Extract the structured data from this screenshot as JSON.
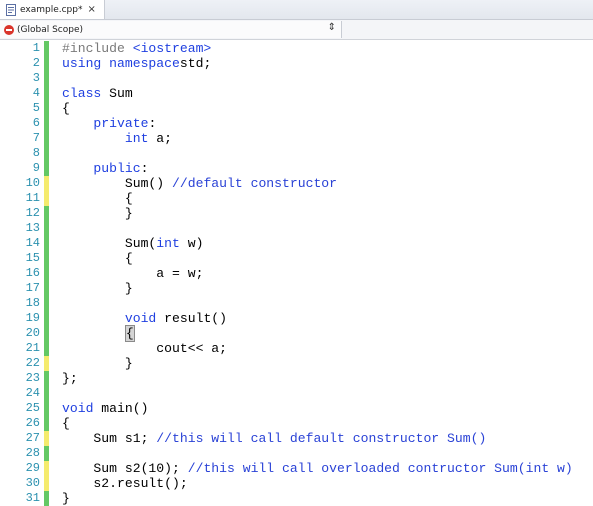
{
  "tab": {
    "title": "example.cpp*",
    "close": "×"
  },
  "scope": {
    "label": "(Global Scope)",
    "chevron": "⇕"
  },
  "colors": {
    "keyword": "#1f3fe0",
    "comment": "#2a42d6",
    "preprocessor": "#7a7a7a",
    "line_number": "#2b91af",
    "change_saved": "#64c864",
    "change_unsaved": "#f5eb6e"
  },
  "code": {
    "lines": [
      {
        "n": "1",
        "chg": "green",
        "tokens": [
          [
            "pp",
            "#include "
          ],
          [
            "kw",
            "<iostream>"
          ]
        ]
      },
      {
        "n": "2",
        "chg": "green",
        "tokens": [
          [
            "kw",
            "using namespace"
          ],
          [
            "",
            "std;"
          ]
        ]
      },
      {
        "n": "3",
        "chg": "green",
        "tokens": []
      },
      {
        "n": "4",
        "chg": "green",
        "tokens": [
          [
            "kw",
            "class"
          ],
          [
            "",
            " Sum"
          ]
        ]
      },
      {
        "n": "5",
        "chg": "green",
        "tokens": [
          [
            "",
            "{"
          ]
        ]
      },
      {
        "n": "6",
        "chg": "green",
        "tokens": [
          [
            "kw",
            "    private"
          ],
          [
            "",
            ":"
          ]
        ]
      },
      {
        "n": "7",
        "chg": "green",
        "tokens": [
          [
            "kw",
            "        int"
          ],
          [
            "",
            " a;"
          ]
        ]
      },
      {
        "n": "8",
        "chg": "green",
        "tokens": []
      },
      {
        "n": "9",
        "chg": "green",
        "tokens": [
          [
            "kw",
            "    public"
          ],
          [
            "",
            ":"
          ]
        ]
      },
      {
        "n": "10",
        "chg": "yellow",
        "tokens": [
          [
            "",
            "        Sum() "
          ],
          [
            "cm",
            "//default constructor"
          ]
        ]
      },
      {
        "n": "11",
        "chg": "yellow",
        "tokens": [
          [
            "",
            "        {"
          ]
        ]
      },
      {
        "n": "12",
        "chg": "green",
        "tokens": [
          [
            "",
            "        }"
          ]
        ]
      },
      {
        "n": "13",
        "chg": "green",
        "tokens": []
      },
      {
        "n": "14",
        "chg": "green",
        "tokens": [
          [
            "",
            "        Sum("
          ],
          [
            "kw",
            "int"
          ],
          [
            "",
            " w)"
          ]
        ]
      },
      {
        "n": "15",
        "chg": "green",
        "tokens": [
          [
            "",
            "        {"
          ]
        ]
      },
      {
        "n": "16",
        "chg": "green",
        "tokens": [
          [
            "",
            "            a = w;"
          ]
        ]
      },
      {
        "n": "17",
        "chg": "green",
        "tokens": [
          [
            "",
            "        }"
          ]
        ]
      },
      {
        "n": "18",
        "chg": "green",
        "tokens": []
      },
      {
        "n": "19",
        "chg": "green",
        "tokens": [
          [
            "kw",
            "        void"
          ],
          [
            "",
            " result()"
          ]
        ]
      },
      {
        "n": "20",
        "chg": "green",
        "tokens": [
          [
            "",
            "        "
          ],
          [
            "hl",
            "{"
          ]
        ]
      },
      {
        "n": "21",
        "chg": "green",
        "tokens": [
          [
            "",
            "            cout<< a;"
          ]
        ]
      },
      {
        "n": "22",
        "chg": "yellow",
        "tokens": [
          [
            "",
            "        }"
          ]
        ]
      },
      {
        "n": "23",
        "chg": "green",
        "tokens": [
          [
            "",
            "};"
          ]
        ]
      },
      {
        "n": "24",
        "chg": "green",
        "tokens": []
      },
      {
        "n": "25",
        "chg": "green",
        "tokens": [
          [
            "kw",
            "void"
          ],
          [
            "",
            " main()"
          ]
        ]
      },
      {
        "n": "26",
        "chg": "green",
        "tokens": [
          [
            "",
            "{"
          ]
        ]
      },
      {
        "n": "27",
        "chg": "yellow",
        "tokens": [
          [
            "",
            "    Sum s1; "
          ],
          [
            "cm",
            "//this will call default constructor Sum()"
          ]
        ]
      },
      {
        "n": "28",
        "chg": "green",
        "tokens": []
      },
      {
        "n": "29",
        "chg": "yellow",
        "tokens": [
          [
            "",
            "    Sum s2(10); "
          ],
          [
            "cm",
            "//this will call overloaded contructor Sum(int w)"
          ]
        ]
      },
      {
        "n": "30",
        "chg": "yellow",
        "tokens": [
          [
            "",
            "    s2.result();"
          ]
        ]
      },
      {
        "n": "31",
        "chg": "green",
        "tokens": [
          [
            "",
            "}"
          ]
        ]
      }
    ]
  }
}
